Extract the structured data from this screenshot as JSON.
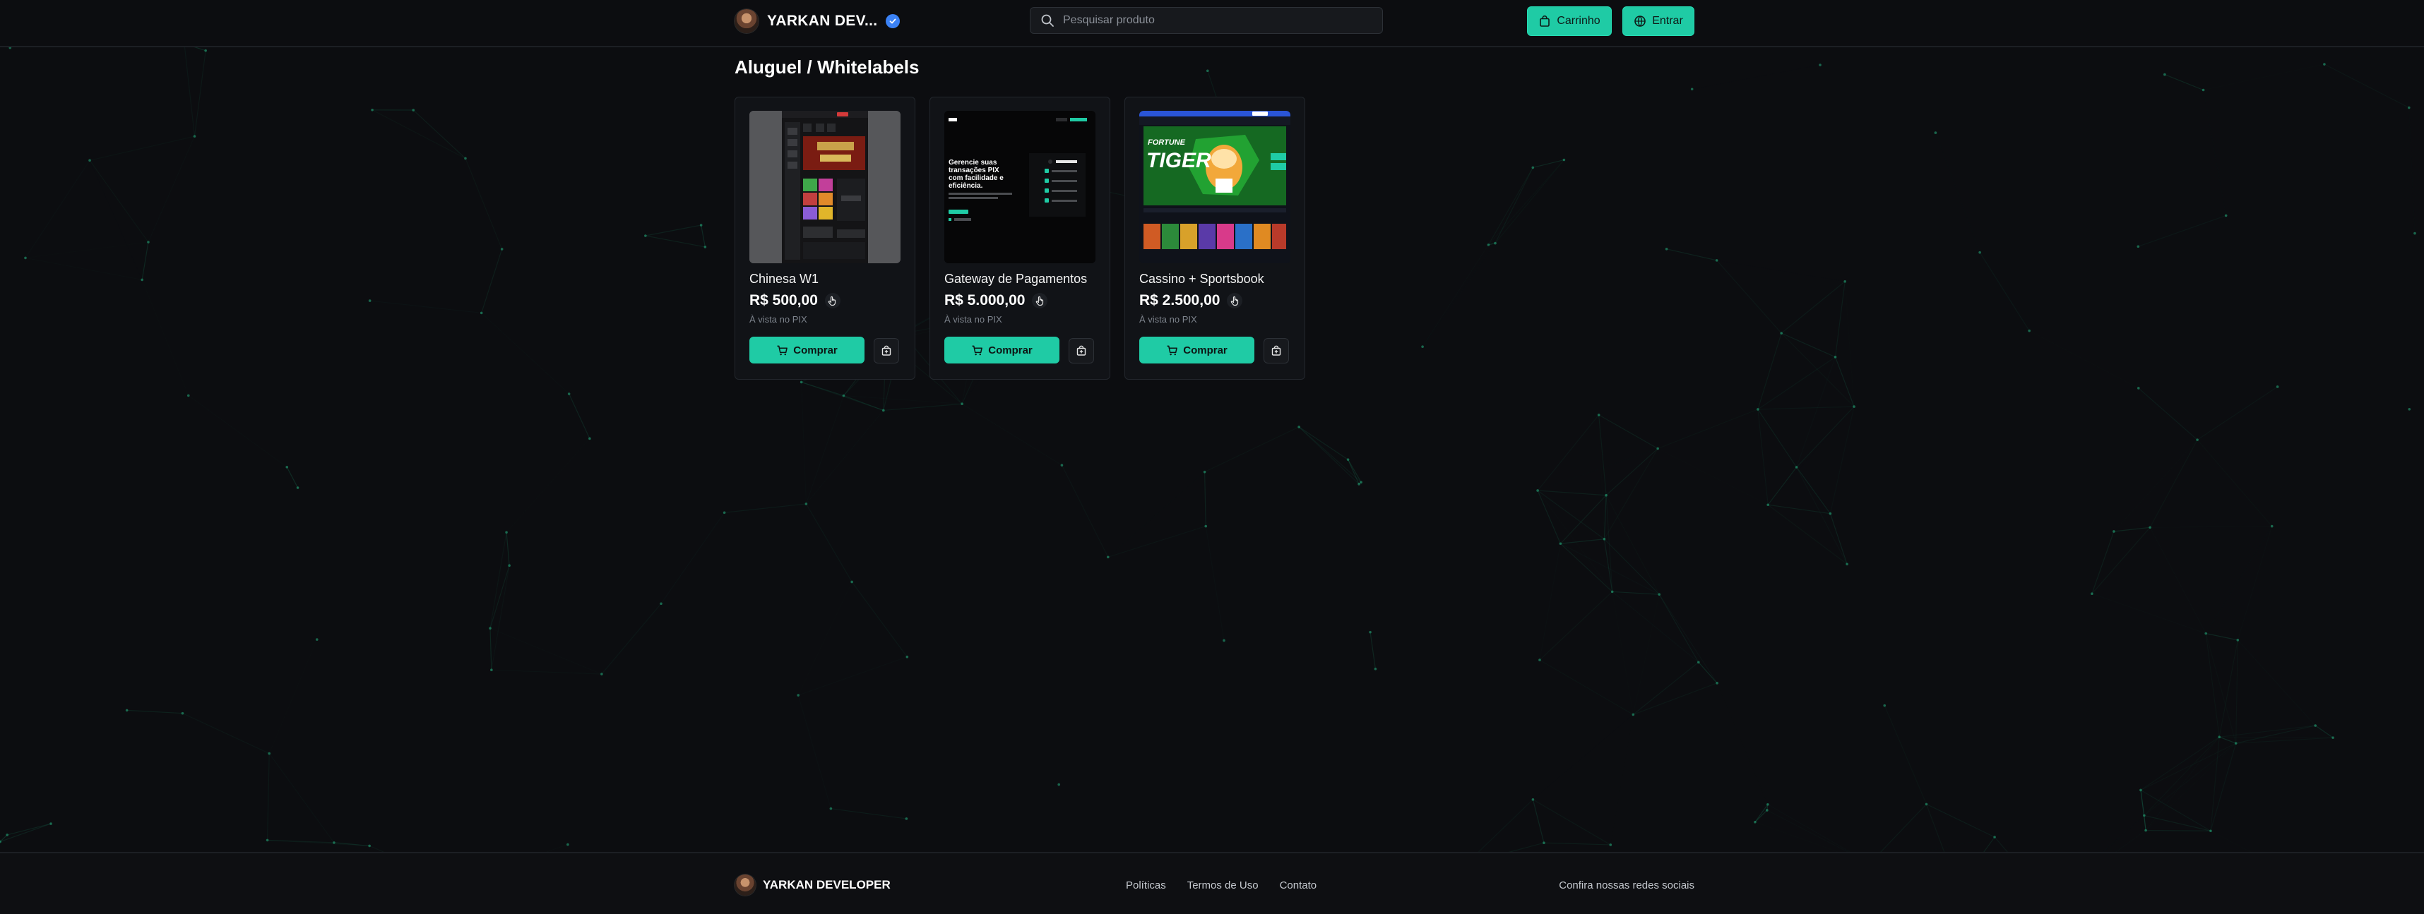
{
  "header": {
    "brand_name": "YARKAN DEV...",
    "search_placeholder": "Pesquisar produto",
    "cart_label": "Carrinho",
    "login_label": "Entrar"
  },
  "section": {
    "title": "Aluguel / Whitelabels"
  },
  "products": [
    {
      "title": "Chinesa W1",
      "price": "R$ 500,00",
      "payment_note": "À vista no PIX",
      "buy_label": "Comprar"
    },
    {
      "title": "Gateway de Pagamentos",
      "price": "R$ 5.000,00",
      "payment_note": "À vista no PIX",
      "buy_label": "Comprar"
    },
    {
      "title": "Cassino + Sportsbook",
      "price": "R$ 2.500,00",
      "payment_note": "À vista no PIX",
      "buy_label": "Comprar"
    }
  ],
  "thumbs": {
    "gateway_headline": [
      "Gerencie suas",
      "transações PIX",
      "com facilidade e",
      "eficiência."
    ],
    "casino_logo": [
      "FORTUNE",
      "TIGER"
    ]
  },
  "footer": {
    "brand_name": "YARKAN DEVELOPER",
    "links": [
      "Políticas",
      "Termos de Uso",
      "Contato"
    ],
    "social_label": "Confira nossas redes sociais"
  },
  "colors": {
    "background": "#0c0d10",
    "accent": "#1fcba5",
    "verified": "#3b82f6"
  }
}
